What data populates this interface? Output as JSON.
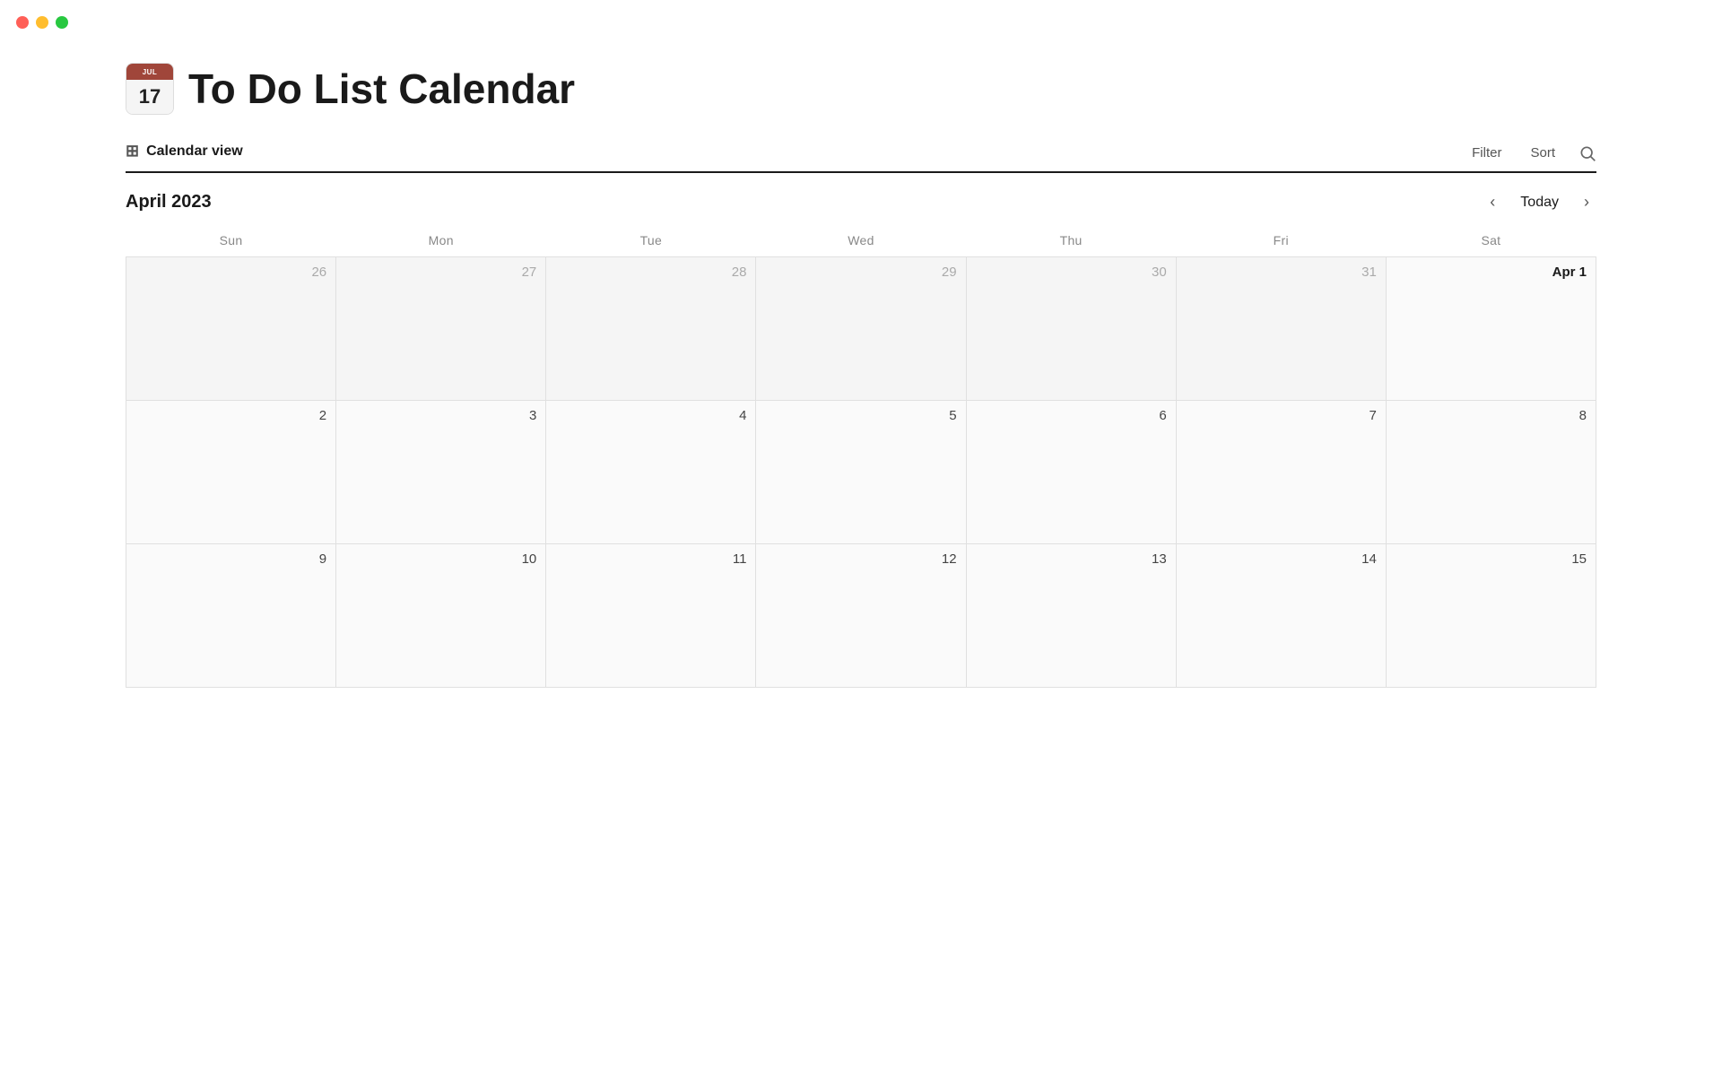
{
  "app": {
    "traffic_lights": [
      "close",
      "minimize",
      "maximize"
    ],
    "title": "To Do List Calendar",
    "calendar_icon": {
      "month_label": "JUL",
      "day_number": "17"
    }
  },
  "toolbar": {
    "view_tab_label": "Calendar view",
    "filter_label": "Filter",
    "sort_label": "Sort",
    "search_label": "Search"
  },
  "calendar": {
    "month_year": "April 2023",
    "today_label": "Today",
    "prev_label": "<",
    "next_label": ">",
    "day_headers": [
      "Sun",
      "Mon",
      "Tue",
      "Wed",
      "Thu",
      "Fri",
      "Sat"
    ],
    "weeks": [
      [
        {
          "number": "26",
          "type": "other"
        },
        {
          "number": "27",
          "type": "other"
        },
        {
          "number": "28",
          "type": "other"
        },
        {
          "number": "29",
          "type": "other"
        },
        {
          "number": "30",
          "type": "other"
        },
        {
          "number": "31",
          "type": "other"
        },
        {
          "number": "Apr 1",
          "type": "first"
        }
      ],
      [
        {
          "number": "2",
          "type": "current"
        },
        {
          "number": "3",
          "type": "current"
        },
        {
          "number": "4",
          "type": "current"
        },
        {
          "number": "5",
          "type": "current"
        },
        {
          "number": "6",
          "type": "current"
        },
        {
          "number": "7",
          "type": "current"
        },
        {
          "number": "8",
          "type": "current"
        }
      ],
      [
        {
          "number": "9",
          "type": "current"
        },
        {
          "number": "10",
          "type": "current"
        },
        {
          "number": "11",
          "type": "current"
        },
        {
          "number": "12",
          "type": "current"
        },
        {
          "number": "13",
          "type": "current"
        },
        {
          "number": "14",
          "type": "current"
        },
        {
          "number": "15",
          "type": "current"
        }
      ]
    ]
  }
}
